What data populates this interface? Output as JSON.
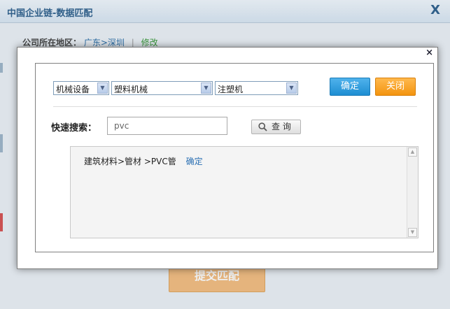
{
  "background_page": {
    "title": "中国企业链-数据匹配",
    "close_glyph": "X",
    "region_label": "公司所在地区：",
    "region_value": "广东>深圳",
    "region_separator": "|",
    "region_edit": "修改",
    "submit_label": "提交匹配"
  },
  "dialog": {
    "close_glyph": "×",
    "selects": [
      {
        "value": "机械设备"
      },
      {
        "value": "塑料机械"
      },
      {
        "value": "注塑机"
      }
    ],
    "confirm_label": "确定",
    "close_label": "关闭",
    "quick_search": {
      "label": "快速搜索：",
      "value": "pvc",
      "button_label": "查 询"
    },
    "results": [
      {
        "path": "建筑材料>管材 >PVC管",
        "action": "确定"
      }
    ]
  },
  "colors": {
    "confirm_button": "#1e8ed2",
    "close_button": "#f3940f",
    "link": "#2a6fb3",
    "submit_button": "#f3b36a"
  }
}
